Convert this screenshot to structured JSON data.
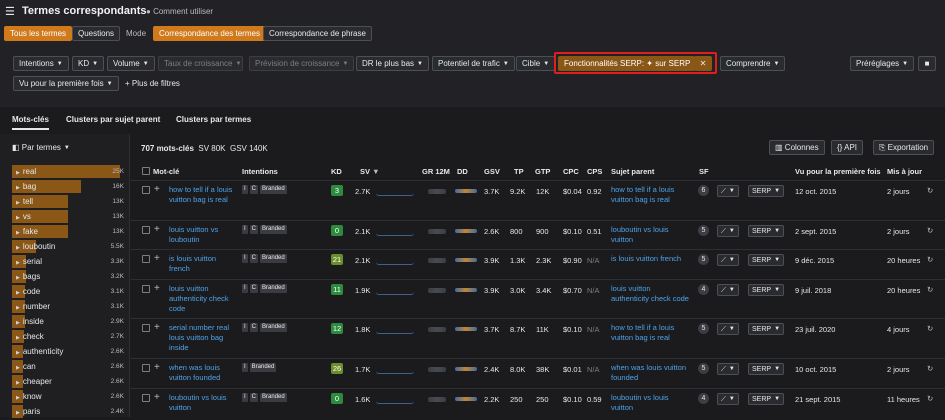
{
  "app": {
    "title": "Termes correspondants",
    "how_to": "Comment utiliser"
  },
  "modes": {
    "all_terms": "Tous les termes",
    "questions": "Questions",
    "mode_label": "Mode",
    "term_match": "Correspondance des termes",
    "phrase_match": "Correspondance de phrase"
  },
  "filters": {
    "intentions": "Intentions",
    "kd": "KD",
    "volume": "Volume",
    "growth_rate": "Taux de croissance",
    "growth_forecast": "Prévision de croissance",
    "serp_low": "DR le plus bas",
    "traffic_potential": "Potentiel de trafic",
    "target": "Cible",
    "serp_features": "Fonctionnalités SERP: ✦ sur SERP",
    "understand": "Comprendre",
    "presets": "Préréglages",
    "first_seen": "Vu pour la première fois",
    "more_filters": "Plus de filtres"
  },
  "tabs": {
    "keywords": "Mots-clés",
    "parent_clusters": "Clusters par sujet parent",
    "term_clusters": "Clusters par termes"
  },
  "summary": {
    "count": "707 mots-clés",
    "sv": "SV 80K",
    "gsv": "GSV 140K"
  },
  "actions": {
    "columns": "Colonnes",
    "api": "API",
    "export": "Exportation"
  },
  "sidebar": {
    "header": "Par termes",
    "terms": [
      {
        "term": "real",
        "count": "25K",
        "pct": 1.0
      },
      {
        "term": "bag",
        "count": "16K",
        "pct": 0.64
      },
      {
        "term": "tell",
        "count": "13K",
        "pct": 0.52
      },
      {
        "term": "vs",
        "count": "13K",
        "pct": 0.52
      },
      {
        "term": "fake",
        "count": "13K",
        "pct": 0.52
      },
      {
        "term": "louboutin",
        "count": "5.5K",
        "pct": 0.22
      },
      {
        "term": "serial",
        "count": "3.3K",
        "pct": 0.13
      },
      {
        "term": "bags",
        "count": "3.2K",
        "pct": 0.13
      },
      {
        "term": "code",
        "count": "3.1K",
        "pct": 0.12
      },
      {
        "term": "number",
        "count": "3.1K",
        "pct": 0.12
      },
      {
        "term": "inside",
        "count": "2.9K",
        "pct": 0.12
      },
      {
        "term": "check",
        "count": "2.7K",
        "pct": 0.11
      },
      {
        "term": "authenticity",
        "count": "2.6K",
        "pct": 0.1
      },
      {
        "term": "can",
        "count": "2.6K",
        "pct": 0.1
      },
      {
        "term": "cheaper",
        "count": "2.6K",
        "pct": 0.1
      },
      {
        "term": "know",
        "count": "2.6K",
        "pct": 0.1
      },
      {
        "term": "paris",
        "count": "2.4K",
        "pct": 0.1
      }
    ]
  },
  "columns": {
    "keyword": "Mot-clé",
    "intentions": "Intentions",
    "kd": "KD",
    "sv": "SV",
    "gr": "GR 12M",
    "dd": "DD",
    "gsv": "GSV",
    "tp": "TP",
    "gtp": "GTP",
    "cpc": "CPC",
    "cps": "CPS",
    "parent": "Sujet parent",
    "sf": "SF",
    "first_seen": "Vu pour la première fois",
    "updated": "Mis à jour"
  },
  "labels": {
    "branded": "Branded",
    "serp": "SERP",
    "i": "I",
    "c": "C"
  },
  "rows": [
    {
      "keyword": "how to tell if a louis vuitton bag is real",
      "ic": true,
      "kd": "3",
      "kd_color": "#2e8b3d",
      "sv": "2.7K",
      "gsv": "3.7K",
      "tp": "9.2K",
      "gtp": "12K",
      "cpc": "$0.04",
      "cps": "0.92",
      "parent": "how to tell if a louis vuitton bag is real",
      "sf": "6",
      "first": "12 oct. 2015",
      "upd": "2 jours"
    },
    {
      "keyword": "louis vuitton vs louboutin",
      "ic": true,
      "kd": "0",
      "kd_color": "#2e8b3d",
      "sv": "2.1K",
      "gsv": "2.6K",
      "tp": "800",
      "gtp": "900",
      "cpc": "$0.10",
      "cps": "0.51",
      "parent": "louboutin vs louis vuitton",
      "sf": "5",
      "first": "2 sept. 2015",
      "upd": "2 jours"
    },
    {
      "keyword": "is louis vuitton french",
      "ic": true,
      "kd": "21",
      "kd_color": "#6a8f2a",
      "sv": "2.1K",
      "gsv": "3.9K",
      "tp": "1.3K",
      "gtp": "2.3K",
      "cpc": "$0.90",
      "cps": "N/A",
      "parent": "is louis vuitton french",
      "sf": "5",
      "first": "9 déc. 2015",
      "upd": "20 heures"
    },
    {
      "keyword": "louis vuitton authenticity check code",
      "ic": true,
      "kd": "11",
      "kd_color": "#2e8b3d",
      "sv": "1.9K",
      "gsv": "3.9K",
      "tp": "3.0K",
      "gtp": "3.4K",
      "cpc": "$0.70",
      "cps": "N/A",
      "parent": "louis vuitton authenticity check code",
      "sf": "4",
      "first": "9 juil. 2018",
      "upd": "20 heures"
    },
    {
      "keyword": "serial number real louis vuitton bag inside",
      "ic": true,
      "kd": "12",
      "kd_color": "#2e8b3d",
      "sv": "1.8K",
      "gsv": "3.7K",
      "tp": "8.7K",
      "gtp": "11K",
      "cpc": "$0.10",
      "cps": "N/A",
      "parent": "how to tell if a louis vuitton bag is real",
      "sf": "5",
      "first": "23 juil. 2020",
      "upd": "4 jours"
    },
    {
      "keyword": "when was louis vuitton founded",
      "ic": false,
      "kd": "26",
      "kd_color": "#6a8f2a",
      "sv": "1.7K",
      "gsv": "2.4K",
      "tp": "8.0K",
      "gtp": "38K",
      "cpc": "$0.01",
      "cps": "N/A",
      "parent": "when was louis vuitton founded",
      "sf": "5",
      "first": "10 oct. 2015",
      "upd": "2 jours"
    },
    {
      "keyword": "louboutin vs louis vuitton",
      "ic": true,
      "kd": "0",
      "kd_color": "#2e8b3d",
      "sv": "1.6K",
      "gsv": "2.2K",
      "tp": "250",
      "gtp": "250",
      "cpc": "$0.10",
      "cps": "0.59",
      "parent": "louboutin vs louis vuitton",
      "sf": "4",
      "first": "21 sept. 2015",
      "upd": "11 heures"
    }
  ],
  "colors": {
    "accent": "#d07a1c",
    "highlight_border": "#e01e1e",
    "link": "#4ea3e8"
  }
}
